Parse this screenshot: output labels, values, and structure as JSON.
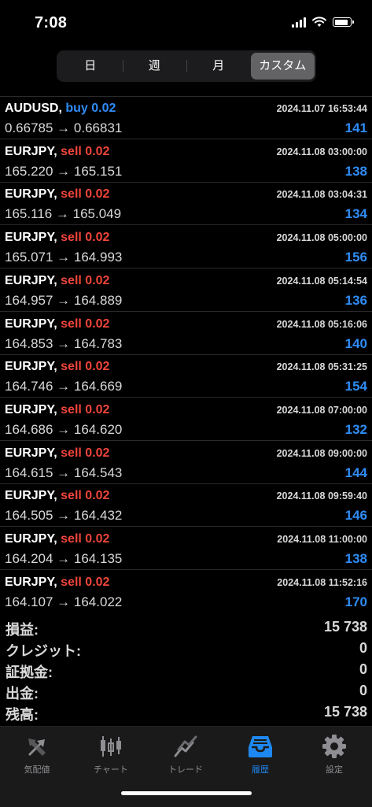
{
  "status": {
    "time": "7:08"
  },
  "segments": [
    {
      "label": "日",
      "active": false
    },
    {
      "label": "週",
      "active": false
    },
    {
      "label": "月",
      "active": false
    },
    {
      "label": "カスタム",
      "active": true
    }
  ],
  "deals": [
    {
      "symbol": "AUDUSD,",
      "side": "buy 0.02",
      "side_type": "buy",
      "time": "2024.11.07 16:53:44",
      "prices": "0.66785 → 0.66831",
      "profit": "141"
    },
    {
      "symbol": "EURJPY,",
      "side": "sell 0.02",
      "side_type": "sell",
      "time": "2024.11.08 03:00:00",
      "prices": "165.220 → 165.151",
      "profit": "138"
    },
    {
      "symbol": "EURJPY,",
      "side": "sell 0.02",
      "side_type": "sell",
      "time": "2024.11.08 03:04:31",
      "prices": "165.116 → 165.049",
      "profit": "134"
    },
    {
      "symbol": "EURJPY,",
      "side": "sell 0.02",
      "side_type": "sell",
      "time": "2024.11.08 05:00:00",
      "prices": "165.071 → 164.993",
      "profit": "156"
    },
    {
      "symbol": "EURJPY,",
      "side": "sell 0.02",
      "side_type": "sell",
      "time": "2024.11.08 05:14:54",
      "prices": "164.957 → 164.889",
      "profit": "136"
    },
    {
      "symbol": "EURJPY,",
      "side": "sell 0.02",
      "side_type": "sell",
      "time": "2024.11.08 05:16:06",
      "prices": "164.853 → 164.783",
      "profit": "140"
    },
    {
      "symbol": "EURJPY,",
      "side": "sell 0.02",
      "side_type": "sell",
      "time": "2024.11.08 05:31:25",
      "prices": "164.746 → 164.669",
      "profit": "154"
    },
    {
      "symbol": "EURJPY,",
      "side": "sell 0.02",
      "side_type": "sell",
      "time": "2024.11.08 07:00:00",
      "prices": "164.686 → 164.620",
      "profit": "132"
    },
    {
      "symbol": "EURJPY,",
      "side": "sell 0.02",
      "side_type": "sell",
      "time": "2024.11.08 09:00:00",
      "prices": "164.615 → 164.543",
      "profit": "144"
    },
    {
      "symbol": "EURJPY,",
      "side": "sell 0.02",
      "side_type": "sell",
      "time": "2024.11.08 09:59:40",
      "prices": "164.505 → 164.432",
      "profit": "146"
    },
    {
      "symbol": "EURJPY,",
      "side": "sell 0.02",
      "side_type": "sell",
      "time": "2024.11.08 11:00:00",
      "prices": "164.204 → 164.135",
      "profit": "138"
    },
    {
      "symbol": "EURJPY,",
      "side": "sell 0.02",
      "side_type": "sell",
      "time": "2024.11.08 11:52:16",
      "prices": "164.107 → 164.022",
      "profit": "170"
    }
  ],
  "summary": [
    {
      "label": "損益:",
      "value": "15 738"
    },
    {
      "label": "クレジット:",
      "value": "0"
    },
    {
      "label": "証拠金:",
      "value": "0"
    },
    {
      "label": "出金:",
      "value": "0"
    },
    {
      "label": "残高:",
      "value": "15 738"
    }
  ],
  "tabs": [
    {
      "label": "気配値",
      "icon": "quotes-icon",
      "active": false
    },
    {
      "label": "チャート",
      "icon": "chart-icon",
      "active": false
    },
    {
      "label": "トレード",
      "icon": "trade-icon",
      "active": false
    },
    {
      "label": "履歴",
      "icon": "history-icon",
      "active": true
    },
    {
      "label": "設定",
      "icon": "settings-icon",
      "active": false
    }
  ],
  "colors": {
    "buy": "#2f8cf5",
    "sell": "#f0453a",
    "accent": "#1e88f2"
  }
}
